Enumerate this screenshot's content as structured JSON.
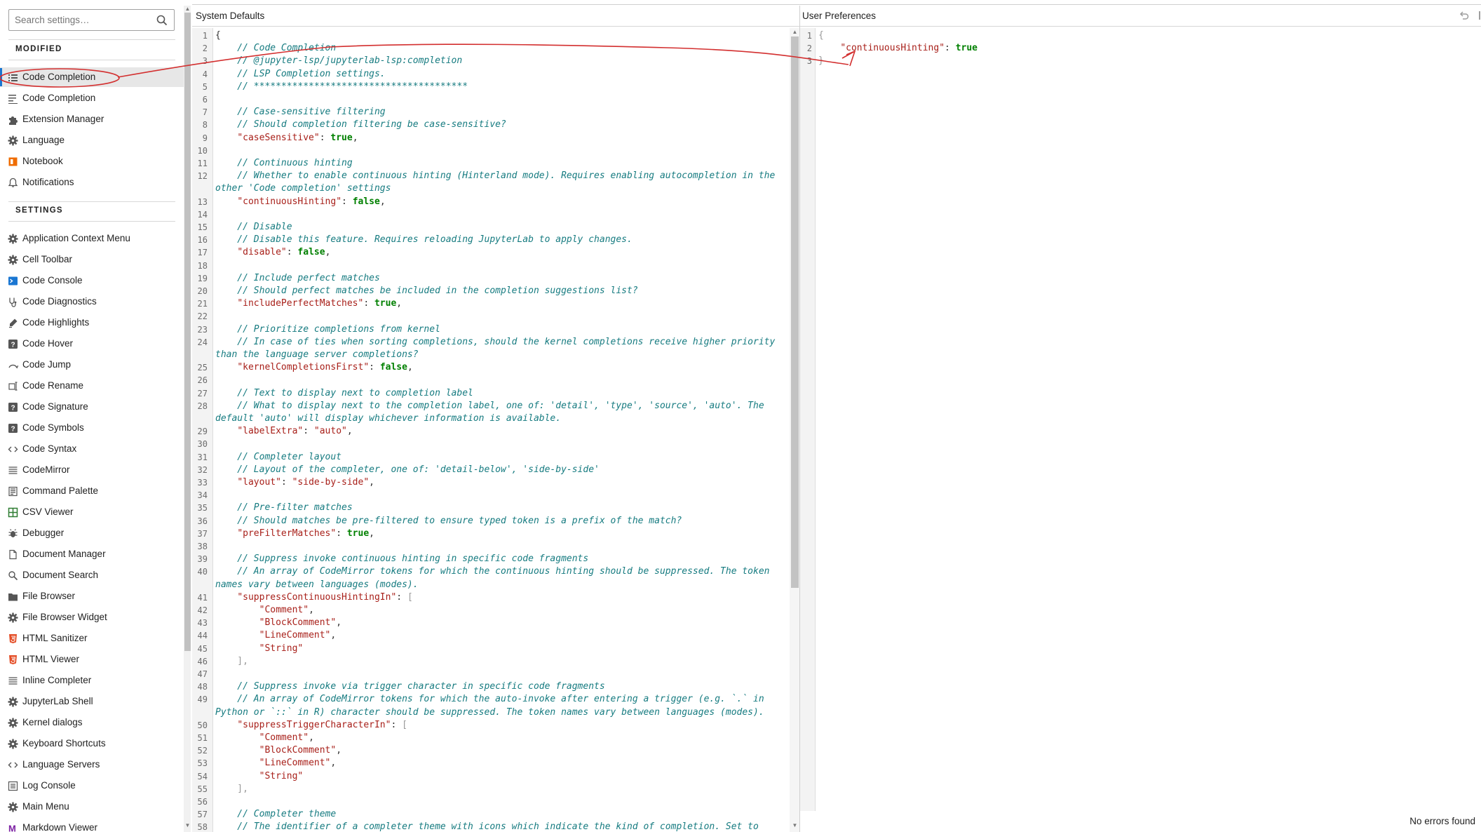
{
  "search": {
    "placeholder": "Search settings…"
  },
  "sections": {
    "modified": "MODIFIED",
    "settings": "SETTINGS"
  },
  "modified_items": [
    {
      "label": "Code Completion",
      "icon": "list-icon"
    },
    {
      "label": "Code Completion",
      "icon": "list-edit-icon"
    },
    {
      "label": "Extension Manager",
      "icon": "puzzle-icon"
    },
    {
      "label": "Language",
      "icon": "gear-icon"
    },
    {
      "label": "Notebook",
      "icon": "notebook-icon"
    },
    {
      "label": "Notifications",
      "icon": "bell-icon"
    }
  ],
  "settings_items": [
    {
      "label": "Application Context Menu",
      "icon": "gear-icon"
    },
    {
      "label": "Cell Toolbar",
      "icon": "gear-icon"
    },
    {
      "label": "Code Console",
      "icon": "console-icon"
    },
    {
      "label": "Code Diagnostics",
      "icon": "stethoscope-icon"
    },
    {
      "label": "Code Highlights",
      "icon": "highlighter-icon"
    },
    {
      "label": "Code Hover",
      "icon": "help-icon"
    },
    {
      "label": "Code Jump",
      "icon": "jump-icon"
    },
    {
      "label": "Code Rename",
      "icon": "rename-icon"
    },
    {
      "label": "Code Signature",
      "icon": "help-icon"
    },
    {
      "label": "Code Symbols",
      "icon": "help-icon"
    },
    {
      "label": "Code Syntax",
      "icon": "code-icon"
    },
    {
      "label": "CodeMirror",
      "icon": "lines-icon"
    },
    {
      "label": "Command Palette",
      "icon": "palette-icon"
    },
    {
      "label": "CSV Viewer",
      "icon": "spreadsheet-icon"
    },
    {
      "label": "Debugger",
      "icon": "bug-icon"
    },
    {
      "label": "Document Manager",
      "icon": "file-icon"
    },
    {
      "label": "Document Search",
      "icon": "search-icon"
    },
    {
      "label": "File Browser",
      "icon": "folder-icon"
    },
    {
      "label": "File Browser Widget",
      "icon": "gear-icon"
    },
    {
      "label": "HTML Sanitizer",
      "icon": "html5-icon"
    },
    {
      "label": "HTML Viewer",
      "icon": "html5-icon"
    },
    {
      "label": "Inline Completer",
      "icon": "lines-icon"
    },
    {
      "label": "JupyterLab Shell",
      "icon": "gear-icon"
    },
    {
      "label": "Kernel dialogs",
      "icon": "gear-icon"
    },
    {
      "label": "Keyboard Shortcuts",
      "icon": "gear-icon"
    },
    {
      "label": "Language Servers",
      "icon": "code-icon"
    },
    {
      "label": "Log Console",
      "icon": "log-icon"
    },
    {
      "label": "Main Menu",
      "icon": "gear-icon"
    },
    {
      "label": "Markdown Viewer",
      "icon": "markdown-icon"
    }
  ],
  "system_defaults": {
    "title": "System Defaults",
    "lines": [
      {
        "n": "1",
        "t": [
          [
            "p",
            "{"
          ]
        ]
      },
      {
        "n": "2",
        "t": [
          [
            "c",
            "    // Code Completion"
          ]
        ]
      },
      {
        "n": "3",
        "t": [
          [
            "c",
            "    // @jupyter-lsp/jupyterlab-lsp:completion"
          ]
        ]
      },
      {
        "n": "4",
        "t": [
          [
            "c",
            "    // LSP Completion settings."
          ]
        ]
      },
      {
        "n": "5",
        "t": [
          [
            "c",
            "    // ***************************************"
          ]
        ]
      },
      {
        "n": "6",
        "t": []
      },
      {
        "n": "7",
        "t": [
          [
            "c",
            "    // Case-sensitive filtering"
          ]
        ]
      },
      {
        "n": "8",
        "t": [
          [
            "c",
            "    // Should completion filtering be case-sensitive?"
          ]
        ]
      },
      {
        "n": "9",
        "t": [
          [
            "p",
            "    "
          ],
          [
            "k",
            "\"caseSensitive\""
          ],
          [
            "p",
            ": "
          ],
          [
            "b",
            "true"
          ],
          [
            "p",
            ","
          ]
        ]
      },
      {
        "n": "10",
        "t": []
      },
      {
        "n": "11",
        "t": [
          [
            "c",
            "    // Continuous hinting"
          ]
        ]
      },
      {
        "n": "12",
        "t": [
          [
            "c",
            "    // Whether to enable continuous hinting (Hinterland mode). Requires enabling autocompletion in the"
          ]
        ]
      },
      {
        "n": "",
        "t": [
          [
            "c",
            "other 'Code completion' settings"
          ]
        ]
      },
      {
        "n": "13",
        "t": [
          [
            "p",
            "    "
          ],
          [
            "k",
            "\"continuousHinting\""
          ],
          [
            "p",
            ": "
          ],
          [
            "b",
            "false"
          ],
          [
            "p",
            ","
          ]
        ]
      },
      {
        "n": "14",
        "t": []
      },
      {
        "n": "15",
        "t": [
          [
            "c",
            "    // Disable"
          ]
        ]
      },
      {
        "n": "16",
        "t": [
          [
            "c",
            "    // Disable this feature. Requires reloading JupyterLab to apply changes."
          ]
        ]
      },
      {
        "n": "17",
        "t": [
          [
            "p",
            "    "
          ],
          [
            "k",
            "\"disable\""
          ],
          [
            "p",
            ": "
          ],
          [
            "b",
            "false"
          ],
          [
            "p",
            ","
          ]
        ]
      },
      {
        "n": "18",
        "t": []
      },
      {
        "n": "19",
        "t": [
          [
            "c",
            "    // Include perfect matches"
          ]
        ]
      },
      {
        "n": "20",
        "t": [
          [
            "c",
            "    // Should perfect matches be included in the completion suggestions list?"
          ]
        ]
      },
      {
        "n": "21",
        "t": [
          [
            "p",
            "    "
          ],
          [
            "k",
            "\"includePerfectMatches\""
          ],
          [
            "p",
            ": "
          ],
          [
            "b",
            "true"
          ],
          [
            "p",
            ","
          ]
        ]
      },
      {
        "n": "22",
        "t": []
      },
      {
        "n": "23",
        "t": [
          [
            "c",
            "    // Prioritize completions from kernel"
          ]
        ]
      },
      {
        "n": "24",
        "t": [
          [
            "c",
            "    // In case of ties when sorting completions, should the kernel completions receive higher priority"
          ]
        ]
      },
      {
        "n": "",
        "t": [
          [
            "c",
            "than the language server completions?"
          ]
        ]
      },
      {
        "n": "25",
        "t": [
          [
            "p",
            "    "
          ],
          [
            "k",
            "\"kernelCompletionsFirst\""
          ],
          [
            "p",
            ": "
          ],
          [
            "b",
            "false"
          ],
          [
            "p",
            ","
          ]
        ]
      },
      {
        "n": "26",
        "t": []
      },
      {
        "n": "27",
        "t": [
          [
            "c",
            "    // Text to display next to completion label"
          ]
        ]
      },
      {
        "n": "28",
        "t": [
          [
            "c",
            "    // What to display next to the completion label, one of: 'detail', 'type', 'source', 'auto'. The"
          ]
        ]
      },
      {
        "n": "",
        "t": [
          [
            "c",
            "default 'auto' will display whichever information is available."
          ]
        ]
      },
      {
        "n": "29",
        "t": [
          [
            "p",
            "    "
          ],
          [
            "k",
            "\"labelExtra\""
          ],
          [
            "p",
            ": "
          ],
          [
            "s",
            "\"auto\""
          ],
          [
            "p",
            ","
          ]
        ]
      },
      {
        "n": "30",
        "t": []
      },
      {
        "n": "31",
        "t": [
          [
            "c",
            "    // Completer layout"
          ]
        ]
      },
      {
        "n": "32",
        "t": [
          [
            "c",
            "    // Layout of the completer, one of: 'detail-below', 'side-by-side'"
          ]
        ]
      },
      {
        "n": "33",
        "t": [
          [
            "p",
            "    "
          ],
          [
            "k",
            "\"layout\""
          ],
          [
            "p",
            ": "
          ],
          [
            "s",
            "\"side-by-side\""
          ],
          [
            "p",
            ","
          ]
        ]
      },
      {
        "n": "34",
        "t": []
      },
      {
        "n": "35",
        "t": [
          [
            "c",
            "    // Pre-filter matches"
          ]
        ]
      },
      {
        "n": "36",
        "t": [
          [
            "c",
            "    // Should matches be pre-filtered to ensure typed token is a prefix of the match?"
          ]
        ]
      },
      {
        "n": "37",
        "t": [
          [
            "p",
            "    "
          ],
          [
            "k",
            "\"preFilterMatches\""
          ],
          [
            "p",
            ": "
          ],
          [
            "b",
            "true"
          ],
          [
            "p",
            ","
          ]
        ]
      },
      {
        "n": "38",
        "t": []
      },
      {
        "n": "39",
        "t": [
          [
            "c",
            "    // Suppress invoke continuous hinting in specific code fragments"
          ]
        ]
      },
      {
        "n": "40",
        "t": [
          [
            "c",
            "    // An array of CodeMirror tokens for which the continuous hinting should be suppressed. The token"
          ]
        ]
      },
      {
        "n": "",
        "t": [
          [
            "c",
            "names vary between languages (modes)."
          ]
        ]
      },
      {
        "n": "41",
        "t": [
          [
            "p",
            "    "
          ],
          [
            "k",
            "\"suppressContinuousHintingIn\""
          ],
          [
            "p",
            ": "
          ],
          [
            "pd",
            "["
          ]
        ]
      },
      {
        "n": "42",
        "t": [
          [
            "p",
            "        "
          ],
          [
            "s",
            "\"Comment\""
          ],
          [
            "p",
            ","
          ]
        ]
      },
      {
        "n": "43",
        "t": [
          [
            "p",
            "        "
          ],
          [
            "s",
            "\"BlockComment\""
          ],
          [
            "p",
            ","
          ]
        ]
      },
      {
        "n": "44",
        "t": [
          [
            "p",
            "        "
          ],
          [
            "s",
            "\"LineComment\""
          ],
          [
            "p",
            ","
          ]
        ]
      },
      {
        "n": "45",
        "t": [
          [
            "p",
            "        "
          ],
          [
            "s",
            "\"String\""
          ]
        ]
      },
      {
        "n": "46",
        "t": [
          [
            "pd",
            "    ],"
          ]
        ]
      },
      {
        "n": "47",
        "t": []
      },
      {
        "n": "48",
        "t": [
          [
            "c",
            "    // Suppress invoke via trigger character in specific code fragments"
          ]
        ]
      },
      {
        "n": "49",
        "t": [
          [
            "c",
            "    // An array of CodeMirror tokens for which the auto-invoke after entering a trigger (e.g. `.` in"
          ]
        ]
      },
      {
        "n": "",
        "t": [
          [
            "c",
            "Python or `::` in R) character should be suppressed. The token names vary between languages (modes)."
          ]
        ]
      },
      {
        "n": "50",
        "t": [
          [
            "p",
            "    "
          ],
          [
            "k",
            "\"suppressTriggerCharacterIn\""
          ],
          [
            "p",
            ": "
          ],
          [
            "pd",
            "["
          ]
        ]
      },
      {
        "n": "51",
        "t": [
          [
            "p",
            "        "
          ],
          [
            "s",
            "\"Comment\""
          ],
          [
            "p",
            ","
          ]
        ]
      },
      {
        "n": "52",
        "t": [
          [
            "p",
            "        "
          ],
          [
            "s",
            "\"BlockComment\""
          ],
          [
            "p",
            ","
          ]
        ]
      },
      {
        "n": "53",
        "t": [
          [
            "p",
            "        "
          ],
          [
            "s",
            "\"LineComment\""
          ],
          [
            "p",
            ","
          ]
        ]
      },
      {
        "n": "54",
        "t": [
          [
            "p",
            "        "
          ],
          [
            "s",
            "\"String\""
          ]
        ]
      },
      {
        "n": "55",
        "t": [
          [
            "pd",
            "    ],"
          ]
        ]
      },
      {
        "n": "56",
        "t": []
      },
      {
        "n": "57",
        "t": [
          [
            "c",
            "    // Completer theme"
          ]
        ]
      },
      {
        "n": "58",
        "t": [
          [
            "c",
            "    // The identifier of a completer theme with icons which indicate the kind of completion. Set to"
          ]
        ]
      }
    ]
  },
  "user_preferences": {
    "title": "User Preferences",
    "lines": [
      {
        "n": "1",
        "t": [
          [
            "pd",
            "{"
          ]
        ]
      },
      {
        "n": "2",
        "t": [
          [
            "p",
            "    "
          ],
          [
            "k",
            "\"continuousHinting\""
          ],
          [
            "p",
            ": "
          ],
          [
            "b",
            "true"
          ]
        ]
      },
      {
        "n": "3",
        "t": [
          [
            "pd",
            "}"
          ]
        ]
      }
    ]
  },
  "status": {
    "text": "No errors found"
  },
  "colors": {
    "comment": "#167b80",
    "key": "#a8201a",
    "bool": "#008000",
    "accent": "#1976d2",
    "annotation": "#d32f2f"
  }
}
